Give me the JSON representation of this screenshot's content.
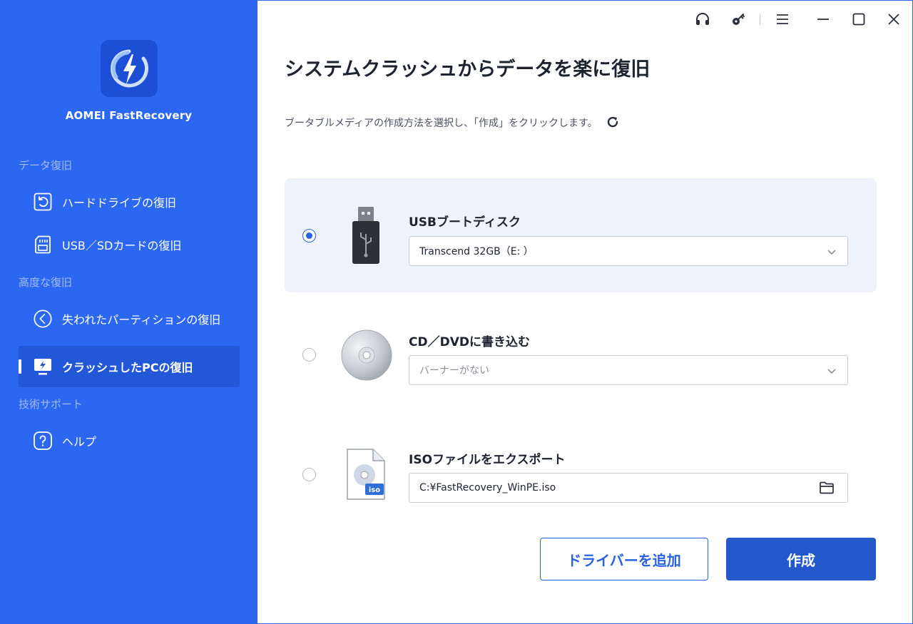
{
  "sidebar": {
    "app_name": "AOMEI FastRecovery",
    "sections": {
      "data_recovery": "データ復旧",
      "advanced": "高度な復旧",
      "support": "技術サポート"
    },
    "items": [
      {
        "label": "ハードドライブの復旧",
        "icon": "undo-box-icon"
      },
      {
        "label": "USB／SDカードの復旧",
        "icon": "sd-card-icon"
      },
      {
        "label": "失われたパーティションの復旧",
        "icon": "partition-icon"
      },
      {
        "label": "クラッシュしたPCの復旧",
        "icon": "monitor-bolt-icon",
        "active": true
      },
      {
        "label": "ヘルプ",
        "icon": "question-icon"
      }
    ]
  },
  "main": {
    "title": "システムクラッシュからデータを楽に復旧",
    "subtitle": "ブータブルメディアの作成方法を選択し、「作成」をクリックします。",
    "options": [
      {
        "title": "USBブートディスク",
        "value": "Transcend 32GB（E: ）",
        "selected": true,
        "icon": "usb-drive-icon"
      },
      {
        "title": "CD／DVDに書き込む",
        "value": "バーナーがない",
        "selected": false,
        "icon": "cd-disc-icon"
      },
      {
        "title": "ISOファイルをエクスポート",
        "value": "C:¥FastRecovery_WinPE.iso",
        "selected": false,
        "icon": "iso-file-icon"
      }
    ],
    "buttons": {
      "add_driver": "ドライバーを追加",
      "create": "作成"
    }
  },
  "colors": {
    "sidebar_bg": "#2b67f0",
    "accent": "#2a63e0",
    "primary_button": "#2457c9",
    "selected_option_bg": "#eef3fb"
  }
}
